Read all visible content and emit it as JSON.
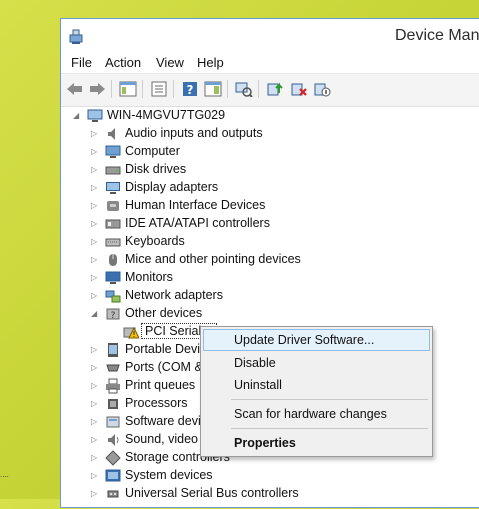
{
  "window": {
    "title": "Device Mana"
  },
  "menu": [
    "File",
    "Action",
    "View",
    "Help"
  ],
  "toolbar": {
    "buttons": [
      "back-arrow-icon",
      "forward-arrow-icon",
      "show-hide-console-tree-icon",
      "properties-icon",
      "help-icon",
      "action-pane-icon",
      "scan-hardware-icon",
      "update-driver-icon",
      "uninstall-device-icon",
      "disable-device-icon"
    ]
  },
  "tree": {
    "root": "WIN-4MGVU7TG029",
    "categories": [
      "Audio inputs and outputs",
      "Computer",
      "Disk drives",
      "Display adapters",
      "Human Interface Devices",
      "IDE ATA/ATAPI controllers",
      "Keyboards",
      "Mice and other pointing devices",
      "Monitors",
      "Network adapters",
      "Other devices",
      "Portable Devic",
      "Ports (COM &",
      "Print queues",
      "Processors",
      "Software devi",
      "Sound, video a",
      "Storage controllers",
      "System devices",
      "Universal Serial Bus controllers"
    ],
    "child_device": "PCI Serial P"
  },
  "context_menu": {
    "update": "Update Driver Software...",
    "disable": "Disable",
    "uninstall": "Uninstall",
    "scan": "Scan for hardware changes",
    "properties": "Properties"
  },
  "colors": {
    "accent": "#6b9bd1",
    "hover": "#e5f1fb",
    "hover_border": "#8fbde6",
    "desktop": "#cfd93f"
  }
}
